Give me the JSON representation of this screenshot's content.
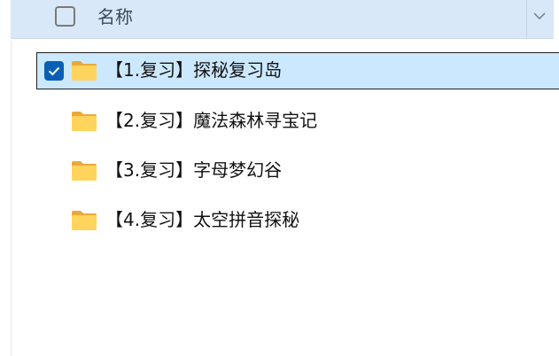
{
  "header": {
    "column_label": "名称",
    "select_all_checked": false,
    "sort_icon": "chevron-down-icon"
  },
  "items": [
    {
      "label": "【1.复习】探秘复习岛",
      "type": "folder",
      "selected": true
    },
    {
      "label": "【2.复习】魔法森林寻宝记",
      "type": "folder",
      "selected": false
    },
    {
      "label": "【3.复习】字母梦幻谷",
      "type": "folder",
      "selected": false
    },
    {
      "label": "【4.复习】太空拼音探秘",
      "type": "folder",
      "selected": false
    }
  ],
  "colors": {
    "header_bg": "#d9e8f8",
    "selected_bg": "#cce8ff",
    "checkbox_accent": "#0a5fb4",
    "folder": "#f5c542"
  }
}
